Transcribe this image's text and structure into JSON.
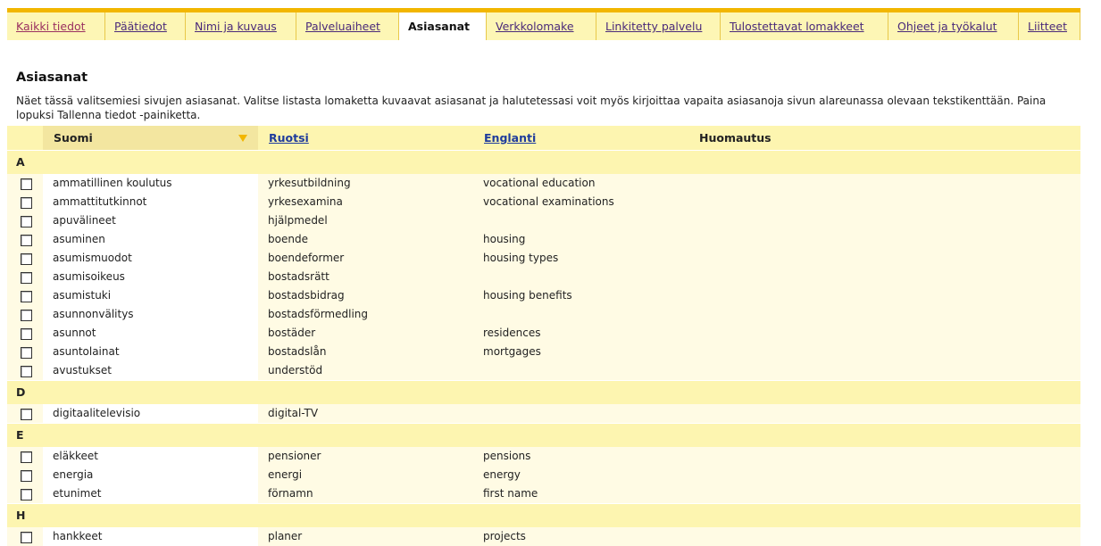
{
  "tabs": [
    {
      "label": "Kaikki tiedot",
      "active": false
    },
    {
      "label": "Päätiedot",
      "active": false
    },
    {
      "label": "Nimi ja kuvaus",
      "active": false
    },
    {
      "label": "Palveluaiheet",
      "active": false
    },
    {
      "label": "Asiasanat",
      "active": true
    },
    {
      "label": "Verkkolomake",
      "active": false
    },
    {
      "label": "Linkitetty palvelu",
      "active": false
    },
    {
      "label": "Tulostettavat lomakkeet",
      "active": false
    },
    {
      "label": "Ohjeet ja työkalut",
      "active": false
    },
    {
      "label": "Liitteet",
      "active": false
    }
  ],
  "page": {
    "title": "Asiasanat",
    "intro": "Näet tässä valitsemiesi sivujen asiasanat. Valitse listasta lomaketta kuvaavat asiasanat ja halutetessasi voit myös kirjoittaa vapaita asiasanoja sivun alareunassa olevaan tekstikenttään. Paina lopuksi Tallenna tiedot -painiketta."
  },
  "table": {
    "headers": {
      "fi": "Suomi",
      "sv": "Ruotsi",
      "en": "Englanti",
      "note": "Huomautus"
    },
    "groups": [
      {
        "letter": "A",
        "rows": [
          {
            "fi": "ammatillinen koulutus",
            "sv": "yrkesutbildning",
            "en": "vocational education"
          },
          {
            "fi": "ammattitutkinnot",
            "sv": "yrkesexamina",
            "en": "vocational examinations"
          },
          {
            "fi": "apuvälineet",
            "sv": "hjälpmedel",
            "en": ""
          },
          {
            "fi": "asuminen",
            "sv": "boende",
            "en": "housing"
          },
          {
            "fi": "asumismuodot",
            "sv": "boendeformer",
            "en": "housing types"
          },
          {
            "fi": "asumisoikeus",
            "sv": "bostadsrätt",
            "en": ""
          },
          {
            "fi": "asumistuki",
            "sv": "bostadsbidrag",
            "en": "housing benefits"
          },
          {
            "fi": "asunnonvälitys",
            "sv": "bostadsförmedling",
            "en": ""
          },
          {
            "fi": "asunnot",
            "sv": "bostäder",
            "en": "residences"
          },
          {
            "fi": "asuntolainat",
            "sv": "bostadslån",
            "en": "mortgages"
          },
          {
            "fi": "avustukset",
            "sv": "understöd",
            "en": ""
          }
        ]
      },
      {
        "letter": "D",
        "rows": [
          {
            "fi": "digitaalitelevisio",
            "sv": "digital-TV",
            "en": ""
          }
        ]
      },
      {
        "letter": "E",
        "rows": [
          {
            "fi": "eläkkeet",
            "sv": "pensioner",
            "en": "pensions"
          },
          {
            "fi": "energia",
            "sv": "energi",
            "en": "energy"
          },
          {
            "fi": "etunimet",
            "sv": "förnamn",
            "en": "first name"
          }
        ]
      },
      {
        "letter": "H",
        "rows": [
          {
            "fi": "hankkeet",
            "sv": "planer",
            "en": "projects"
          }
        ]
      }
    ]
  },
  "colors": {
    "accent": "#f2b600",
    "header_bg": "#fdf5b0",
    "row_bg": "#fffbe4",
    "link": "#1f3c9c"
  }
}
